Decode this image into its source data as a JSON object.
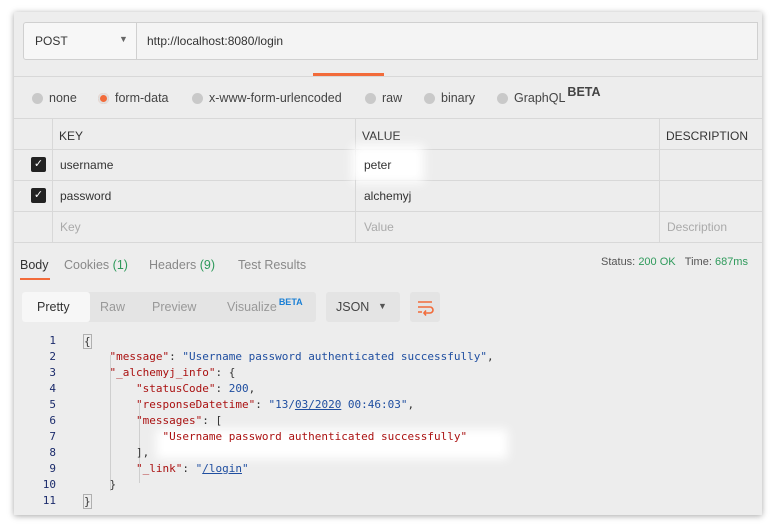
{
  "request": {
    "method": "POST",
    "url": "http://localhost:8080/login"
  },
  "body_types": [
    {
      "label": "none",
      "selected": false
    },
    {
      "label": "form-data",
      "selected": true
    },
    {
      "label": "x-www-form-urlencoded",
      "selected": false
    },
    {
      "label": "raw",
      "selected": false
    },
    {
      "label": "binary",
      "selected": false
    },
    {
      "label": "GraphQL",
      "selected": false,
      "badge": "BETA"
    }
  ],
  "params_table": {
    "headers": {
      "key": "KEY",
      "value": "VALUE",
      "description": "DESCRIPTION"
    },
    "rows": [
      {
        "checked": true,
        "key": "username",
        "value": "peter"
      },
      {
        "checked": true,
        "key": "password",
        "value": "alchemyj"
      }
    ],
    "placeholders": {
      "key": "Key",
      "value": "Value",
      "description": "Description"
    }
  },
  "response_tabs": {
    "body": "Body",
    "cookies": "Cookies",
    "cookies_count": "(1)",
    "headers": "Headers",
    "headers_count": "(9)",
    "tests": "Test Results"
  },
  "status": {
    "status_label": "Status:",
    "status_value": "200 OK",
    "time_label": "Time:",
    "time_value": "687ms"
  },
  "view_modes": {
    "pretty": "Pretty",
    "raw": "Raw",
    "preview": "Preview",
    "visualize": "Visualize",
    "visualize_badge": "BETA"
  },
  "format": "JSON",
  "code_lines": [
    "1",
    "2",
    "3",
    "4",
    "5",
    "6",
    "7",
    "8",
    "9",
    "10",
    "11"
  ],
  "response_json": {
    "message_key": "\"message\"",
    "message_val": "\"Username password authenticated successfully\"",
    "info_key": "\"_alchemyj_info\"",
    "status_key": "\"statusCode\"",
    "status_val": "200",
    "dt_key": "\"responseDatetime\"",
    "dt_val_a": "\"13/",
    "dt_val_b": "03/2020",
    "dt_val_c": " 00:46:03\"",
    "messages_key": "\"messages\"",
    "messages_item": "\"Username password authenticated successfully\"",
    "link_key": "\"_link\"",
    "link_val_a": "\"",
    "link_val_b": "/login",
    "link_val_c": "\""
  },
  "colors": {
    "accent": "#f26b3a",
    "status_green": "#2e9a5b",
    "beta_blue": "#1a7fd4"
  }
}
